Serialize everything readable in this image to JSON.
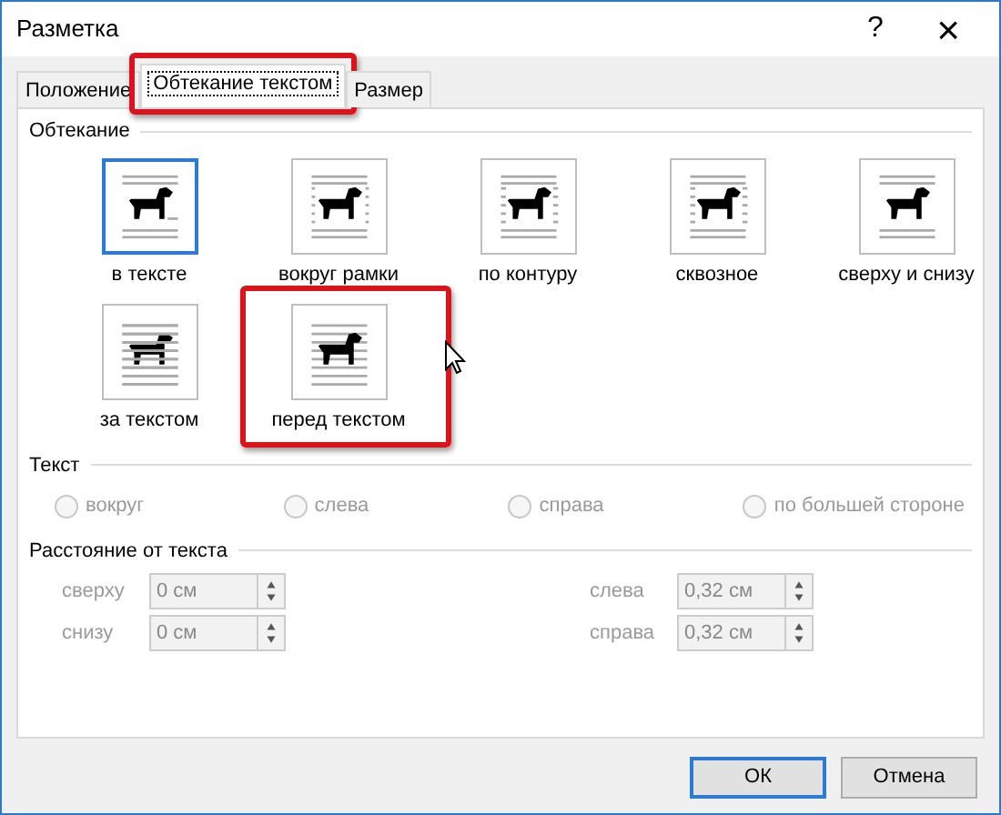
{
  "window": {
    "title": "Разметка",
    "help": "?",
    "close": "×"
  },
  "tabs": [
    {
      "label": "Положение",
      "selected": false,
      "highlighted": false
    },
    {
      "label": "Обтекание текстом",
      "selected": true,
      "highlighted": true
    },
    {
      "label": "Размер",
      "selected": false,
      "highlighted": false
    }
  ],
  "wrapping": {
    "title": "Обтекание",
    "options": [
      {
        "label": "в тексте",
        "kind": "inline",
        "selected": true,
        "highlighted": false
      },
      {
        "label": "вокруг рамки",
        "kind": "square",
        "selected": false,
        "highlighted": false
      },
      {
        "label": "по контуру",
        "kind": "tight",
        "selected": false,
        "highlighted": false
      },
      {
        "label": "сквозное",
        "kind": "through",
        "selected": false,
        "highlighted": false
      },
      {
        "label": "сверху и снизу",
        "kind": "topbottom",
        "selected": false,
        "highlighted": false
      },
      {
        "label": "за текстом",
        "kind": "behind",
        "selected": false,
        "highlighted": false
      },
      {
        "label": "перед текстом",
        "kind": "front",
        "selected": false,
        "highlighted": true
      }
    ]
  },
  "text": {
    "title": "Текст",
    "options": [
      {
        "label": "вокруг",
        "selected": false,
        "disabled": true
      },
      {
        "label": "слева",
        "selected": false,
        "disabled": true
      },
      {
        "label": "справа",
        "selected": false,
        "disabled": true
      },
      {
        "label": "по большей стороне",
        "selected": false,
        "disabled": true
      }
    ]
  },
  "distance": {
    "title": "Расстояние от текста",
    "fields": [
      {
        "label": "сверху",
        "value": "0 см",
        "disabled": true
      },
      {
        "label": "слева",
        "value": "0,32 см",
        "disabled": true
      },
      {
        "label": "снизу",
        "value": "0 см",
        "disabled": true
      },
      {
        "label": "справа",
        "value": "0,32 см",
        "disabled": true
      }
    ]
  },
  "buttons": [
    {
      "label": "ОК",
      "default": true
    },
    {
      "label": "Отмена",
      "default": false
    }
  ]
}
